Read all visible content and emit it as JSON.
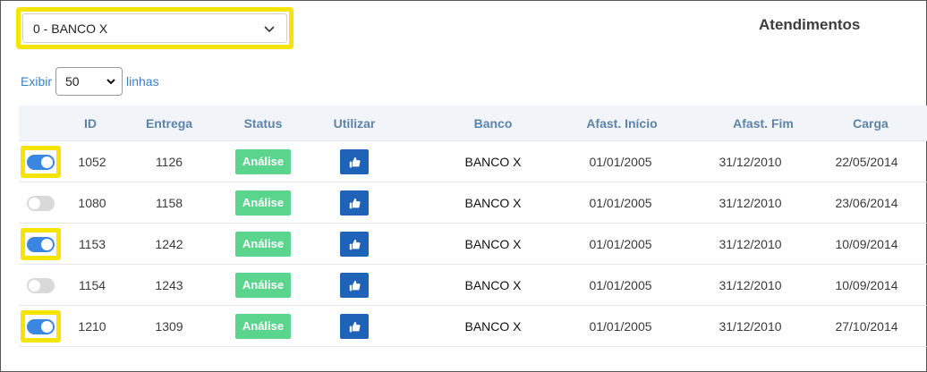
{
  "bank_filter": {
    "selected": "0 - BANCO X",
    "icon": "chevron-down-icon"
  },
  "page_title": "Atendimentos",
  "length_menu": {
    "prefix": "Exibir",
    "value": "50",
    "suffix": "linhas"
  },
  "columns": {
    "id": "ID",
    "entrega": "Entrega",
    "status": "Status",
    "utilizar": "Utilizar",
    "banco": "Banco",
    "inicio": "Afast. Início",
    "fim": "Afast. Fim",
    "carga": "Carga"
  },
  "rows": [
    {
      "active": true,
      "highlighted": true,
      "id": "1052",
      "entrega": "1126",
      "status": "Análise",
      "banco": "BANCO X",
      "inicio": "01/01/2005",
      "fim": "31/12/2010",
      "carga": "22/05/2014"
    },
    {
      "active": false,
      "highlighted": false,
      "id": "1080",
      "entrega": "1158",
      "status": "Análise",
      "banco": "BANCO X",
      "inicio": "01/01/2005",
      "fim": "31/12/2010",
      "carga": "23/06/2014"
    },
    {
      "active": true,
      "highlighted": true,
      "id": "1153",
      "entrega": "1242",
      "status": "Análise",
      "banco": "BANCO X",
      "inicio": "01/01/2005",
      "fim": "31/12/2010",
      "carga": "10/09/2014"
    },
    {
      "active": false,
      "highlighted": false,
      "id": "1154",
      "entrega": "1243",
      "status": "Análise",
      "banco": "BANCO X",
      "inicio": "01/01/2005",
      "fim": "31/12/2010",
      "carga": "10/09/2014"
    },
    {
      "active": true,
      "highlighted": true,
      "id": "1210",
      "entrega": "1309",
      "status": "Análise",
      "banco": "BANCO X",
      "inicio": "01/01/2005",
      "fim": "31/12/2010",
      "carga": "27/10/2014"
    }
  ],
  "colors": {
    "highlight": "#f5e400",
    "toggle_on": "#3a86e0",
    "toggle_off": "#d9d9d9",
    "status_badge": "#5bd48e",
    "use_button": "#1e63b8",
    "header_text": "#5e84a8"
  },
  "use_button_icon": "thumbs-up-icon"
}
